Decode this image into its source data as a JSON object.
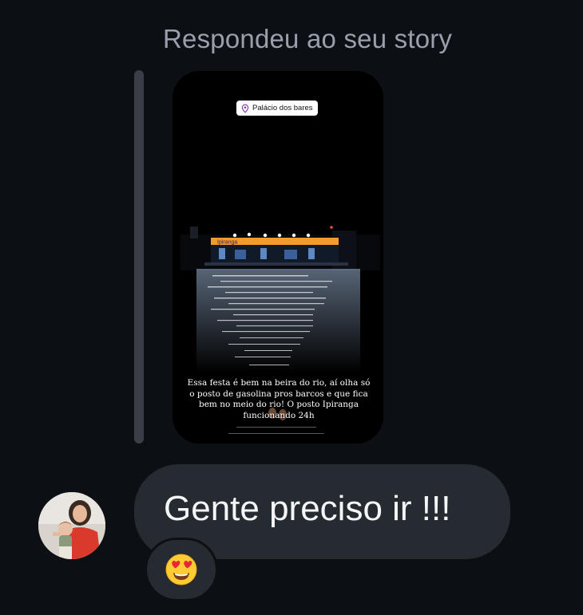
{
  "thread": {
    "reply_header": "Respondeu ao seu story"
  },
  "story": {
    "location": "Palácio dos bares",
    "location_icon": "map-pin-icon",
    "station_sign": "Ipiranga",
    "caption": "Essa festa é bem na beira do rio, aí olha só o posto de gasolina pros barcos e que fica bem no meio do rio! O posto Ipiranga funcionando 24h"
  },
  "message": {
    "text": "Gente preciso ir !!!",
    "reaction": "😍",
    "reaction_icon": "heart-eyes-emoji-icon"
  },
  "colors": {
    "background": "#0c0f14",
    "bubble": "#262a31",
    "header_text": "#9aa0ab",
    "station_orange": "#f39b2b"
  }
}
